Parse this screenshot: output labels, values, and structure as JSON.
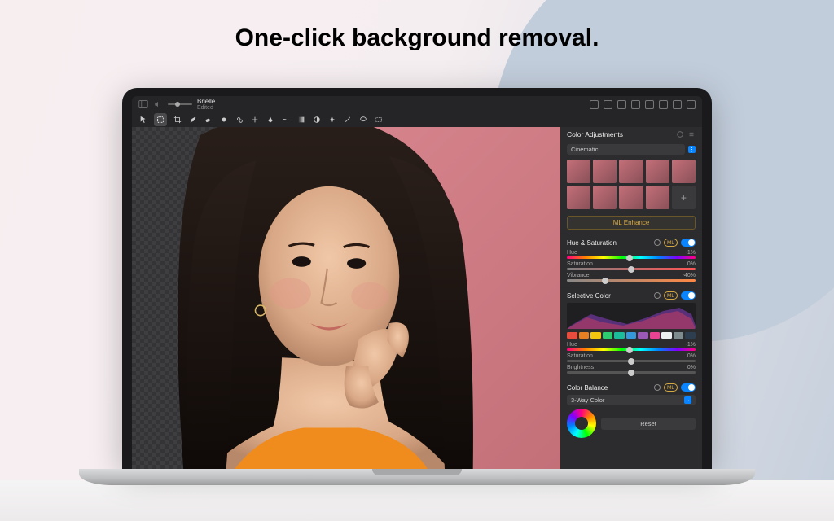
{
  "marketing": {
    "headline": "One-click background removal."
  },
  "document": {
    "name": "Brielle",
    "status": "Edited"
  },
  "panel": {
    "title": "Color Adjustments",
    "preset": "Cinematic",
    "ml_enhance": "ML Enhance",
    "ml_badge": "ML"
  },
  "hue_sat": {
    "title": "Hue & Saturation",
    "sliders": [
      {
        "label": "Hue",
        "value": "-1%",
        "pos": 49
      },
      {
        "label": "Saturation",
        "value": "0%",
        "pos": 50
      },
      {
        "label": "Vibrance",
        "value": "-40%",
        "pos": 30
      }
    ]
  },
  "selective": {
    "title": "Selective Color",
    "swatches": [
      "#e74c3c",
      "#e67e22",
      "#f1c40f",
      "#2ecc71",
      "#1abc9c",
      "#3498db",
      "#9b59b6",
      "#e84393",
      "#ecf0f1",
      "#7f8c8d",
      "#2c3e50"
    ],
    "sliders": [
      {
        "label": "Hue",
        "value": "-1%",
        "pos": 49
      },
      {
        "label": "Saturation",
        "value": "0%",
        "pos": 50
      },
      {
        "label": "Brightness",
        "value": "0%",
        "pos": 50
      }
    ]
  },
  "balance": {
    "title": "Color Balance",
    "mode": "3-Way Color",
    "reset": "Reset"
  }
}
